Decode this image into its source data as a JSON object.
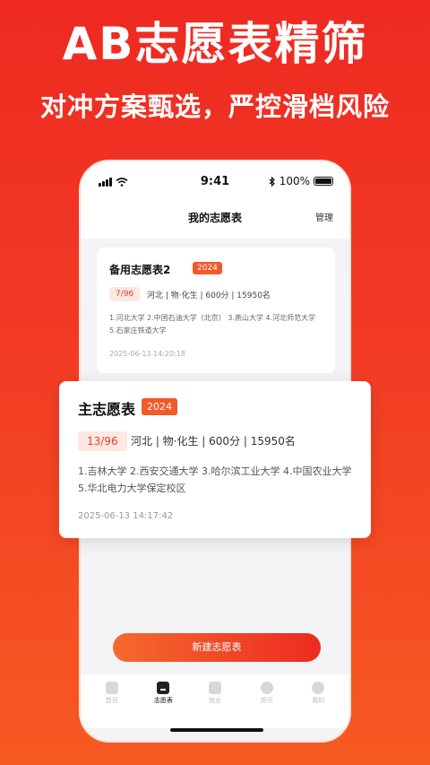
{
  "promo": {
    "headline": "AB志愿表精筛",
    "subheadline": "对冲方案甄选，严控滑档风险"
  },
  "status_bar": {
    "time": "9:41",
    "battery_text": "100%"
  },
  "nav": {
    "title": "我的志愿表",
    "manage": "管理"
  },
  "cards": [
    {
      "title": "备用志愿表2",
      "year": "2024",
      "rank": "7/96",
      "meta": "河北 | 物·化生 | 600分 | 15950名",
      "schools": "1.河北大学 2.中国石油大学（北京） 3.燕山大学 4.河北师范大学 5.石家庄铁道大学",
      "date": "2025-06-13 14:20:18"
    },
    {
      "title": "主志愿表",
      "year": "2024",
      "rank": "13/96",
      "meta": "河北 | 物·化生 | 600分 | 15950名",
      "schools": "1.吉林大学 2.西安交通大学 3.哈尔滨工业大学 4.中国农业大学 5.华北电力大学保定校区",
      "date": "2025-06-13 14:17:42"
    }
  ],
  "new_button": "新建志愿表",
  "tabs": [
    {
      "label": "首页",
      "icon": "home-icon",
      "active": false
    },
    {
      "label": "志愿表",
      "icon": "form-icon",
      "active": true
    },
    {
      "label": "就业",
      "icon": "briefcase-icon",
      "active": false
    },
    {
      "label": "资讯",
      "icon": "compass-icon",
      "active": false
    },
    {
      "label": "我的",
      "icon": "profile-icon",
      "active": false
    }
  ],
  "colors": {
    "brand_red": "#ee2a22",
    "brand_orange": "#f46a2c"
  }
}
